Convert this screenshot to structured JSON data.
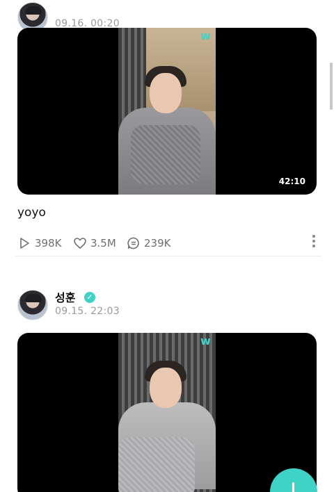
{
  "posts": [
    {
      "author": "",
      "date": "09.16. 00:20",
      "duration": "42:10",
      "caption": "yoyo",
      "views": "398K",
      "likes": "3.5M",
      "comments": "239K"
    },
    {
      "author": "성훈",
      "date": "09.15. 22:03"
    }
  ],
  "icons": {
    "views": "play-icon",
    "likes": "heart-icon",
    "comments": "comment-icon",
    "more": "more-vertical-icon",
    "verified": "verified-badge-icon",
    "fab": "plus-icon"
  },
  "colors": {
    "accent": "#3fd2c6",
    "text": "#111111",
    "muted": "#9a9a9a"
  }
}
